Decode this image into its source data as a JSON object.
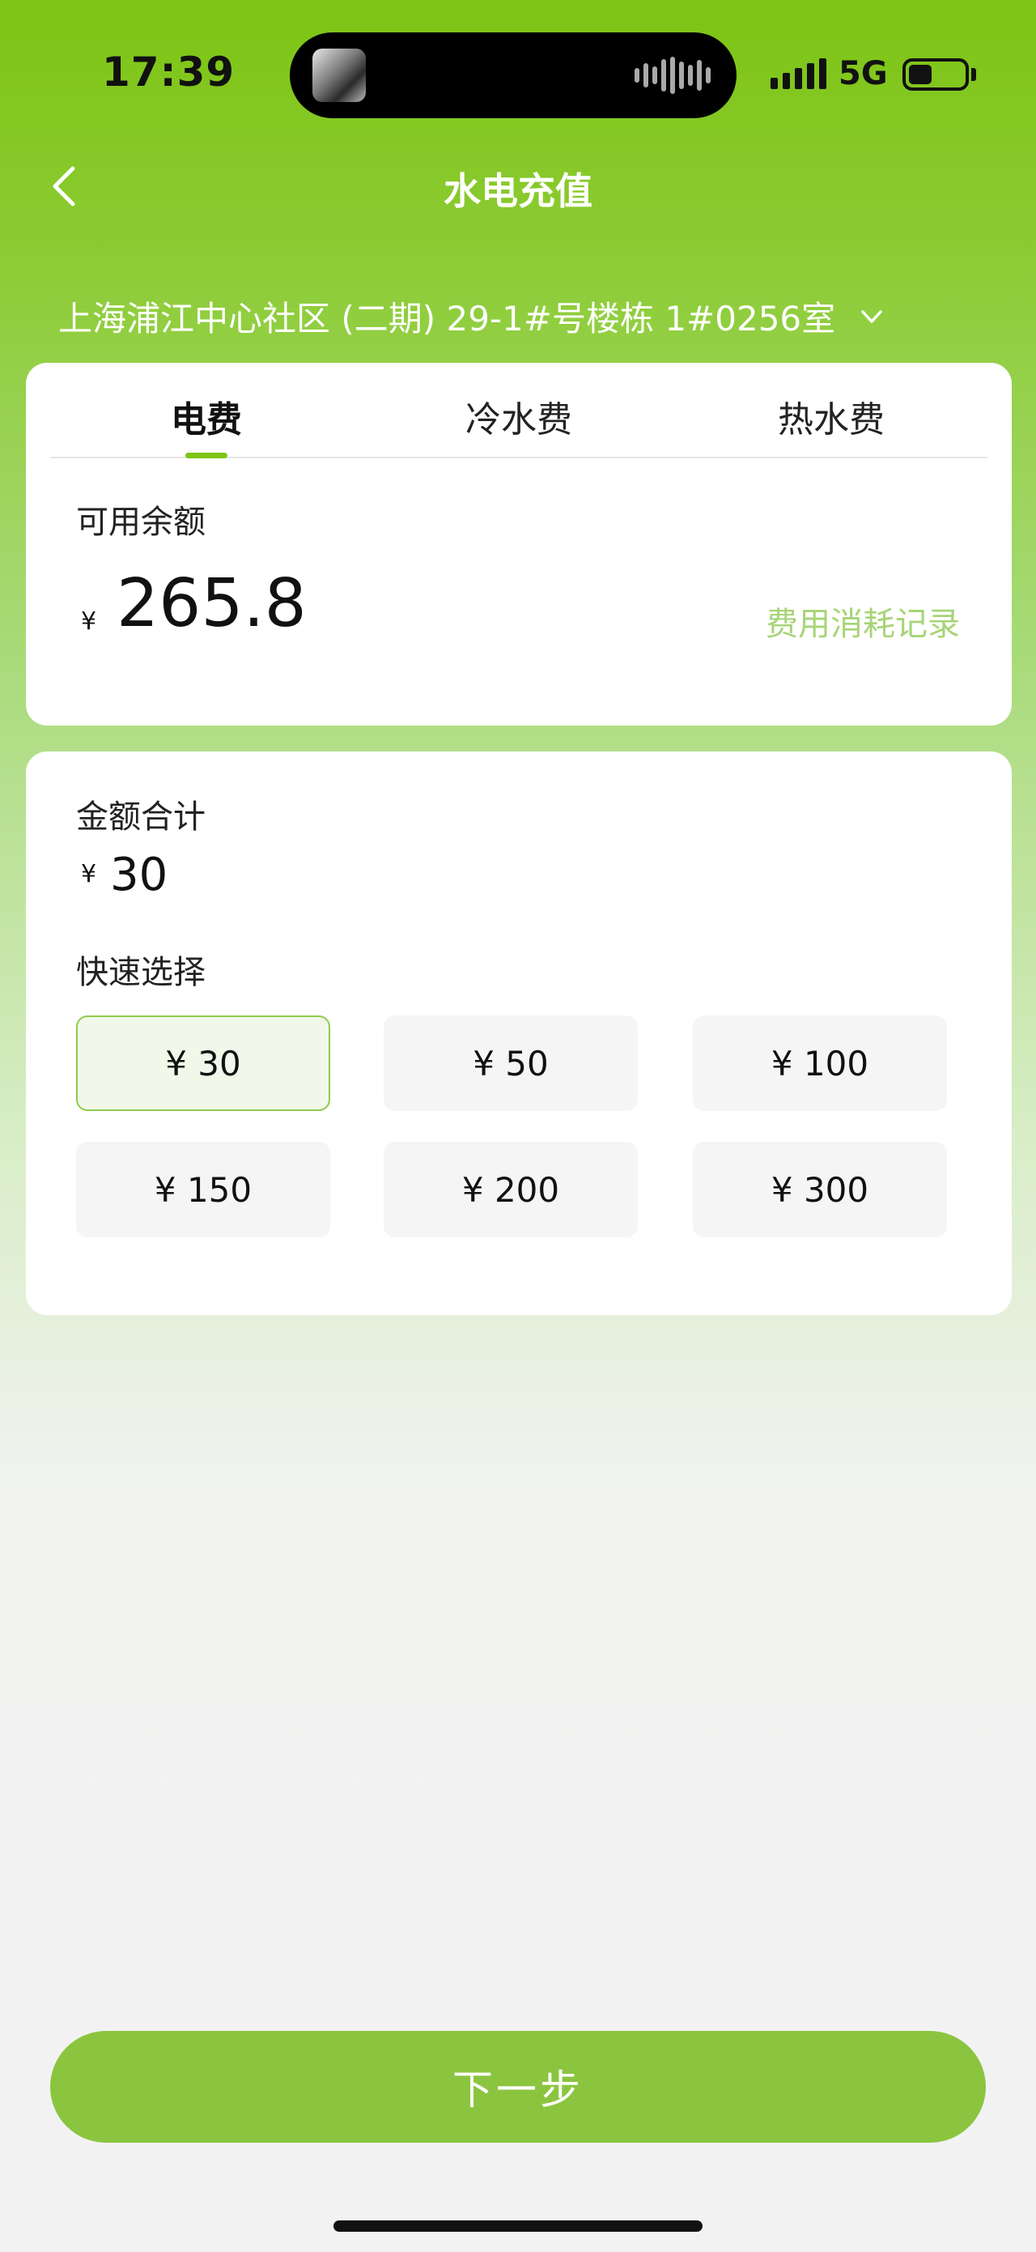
{
  "status_bar": {
    "time": "17:39",
    "network": "5G"
  },
  "nav": {
    "title": "水电充值"
  },
  "address": {
    "text": "上海浦江中心社区 (二期) 29-1#号楼栋 1#0256室"
  },
  "tabs": [
    {
      "label": "电费",
      "active": true
    },
    {
      "label": "冷水费",
      "active": false
    },
    {
      "label": "热水费",
      "active": false
    }
  ],
  "balance": {
    "label": "可用余额",
    "currency": "¥",
    "value": "265.8",
    "record_link": "费用消耗记录"
  },
  "amount": {
    "sum_label": "金额合计",
    "currency": "¥",
    "sum_value": "30",
    "quick_label": "快速选择",
    "options": [
      {
        "label": "¥ 30",
        "selected": true
      },
      {
        "label": "¥ 50",
        "selected": false
      },
      {
        "label": "¥ 100",
        "selected": false
      },
      {
        "label": "¥ 150",
        "selected": false
      },
      {
        "label": "¥ 200",
        "selected": false
      },
      {
        "label": "¥ 300",
        "selected": false
      }
    ]
  },
  "footer": {
    "next_label": "下一步"
  },
  "colors": {
    "brand": "#7dc414",
    "button": "#8bc53f",
    "link": "#a7d478"
  }
}
